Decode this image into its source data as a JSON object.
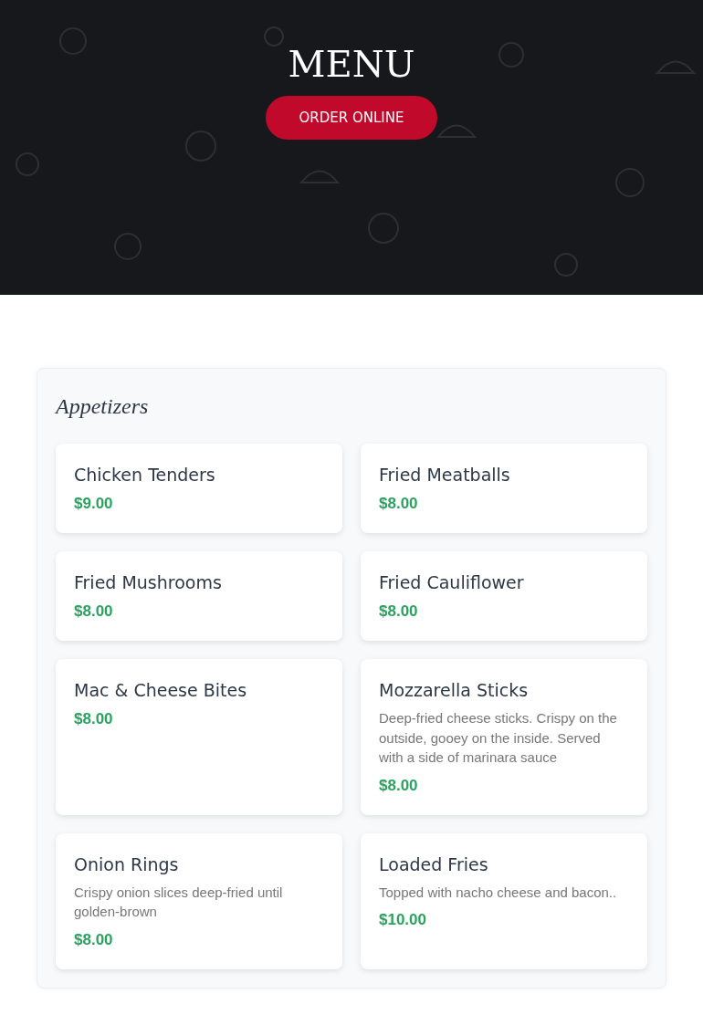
{
  "hero": {
    "title": "MENU",
    "button": "ORDER ONLINE"
  },
  "sections": [
    {
      "title": "Appetizers",
      "items": [
        {
          "name": "Chicken Tenders",
          "price": "$9.00"
        },
        {
          "name": "Fried Meatballs",
          "price": "$8.00"
        },
        {
          "name": "Fried Mushrooms",
          "price": "$8.00"
        },
        {
          "name": "Fried Cauliflower",
          "price": "$8.00"
        },
        {
          "name": "Mac & Cheese Bites",
          "price": "$8.00"
        },
        {
          "name": "Mozzarella Sticks",
          "description": "Deep-fried cheese sticks. Crispy on the outside, gooey on the inside. Served with a side of marinara sauce",
          "price": "$8.00"
        },
        {
          "name": "Onion Rings",
          "description": "Crispy onion slices deep-fried until golden-brown",
          "price": "$8.00"
        },
        {
          "name": "Loaded Fries",
          "description": "Topped with nacho cheese and bacon..",
          "price": "$10.00"
        }
      ]
    }
  ]
}
